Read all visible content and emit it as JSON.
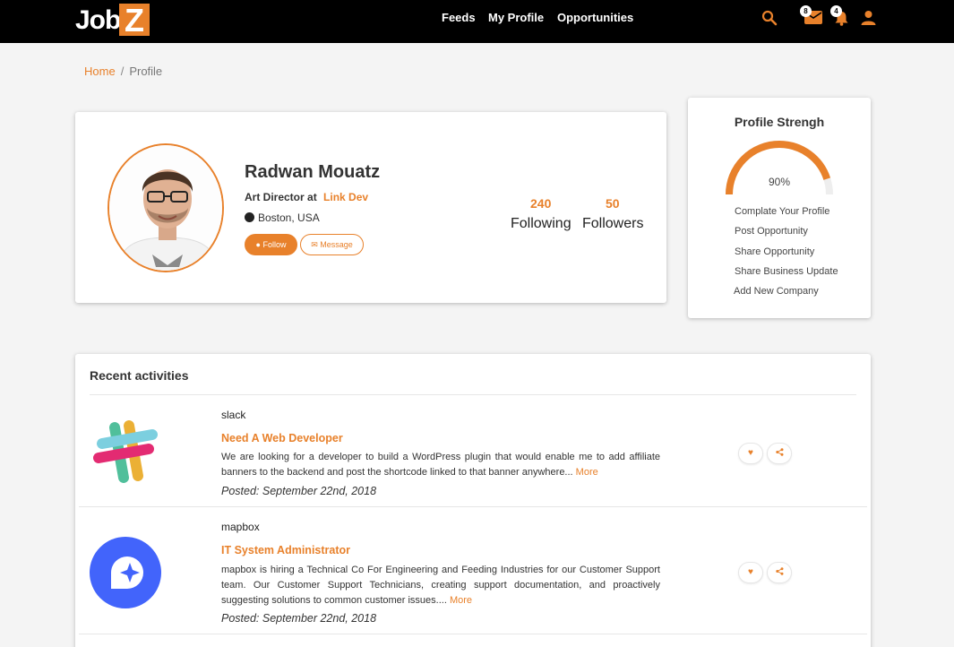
{
  "app": {
    "logo_prefix": "Job",
    "logo_z": "Z"
  },
  "nav": {
    "items": [
      {
        "label": "Feeds"
      },
      {
        "label": "My Profile"
      },
      {
        "label": "Opportunities"
      }
    ],
    "icons": [
      {
        "name": "search-icon"
      },
      {
        "name": "mail-icon",
        "badge": "8"
      },
      {
        "name": "bell-icon",
        "badge": "4"
      },
      {
        "name": "user-icon"
      }
    ]
  },
  "breadcrumb": {
    "home": "Home",
    "separator": "/",
    "current": "Profile"
  },
  "profile": {
    "name": "Radwan Mouatz",
    "title": "Art Director",
    "at": "at",
    "company": "Link Dev",
    "location": "Boston, USA",
    "follow_label": "Follow",
    "message_label": "Message",
    "following_count": "240",
    "following_label": "Following",
    "followers_count": "50",
    "followers_label": "Followers"
  },
  "strength": {
    "title": "Profile Strengh",
    "percent": "90%",
    "value": 0.9,
    "links": [
      "Complate Your Profile",
      "Post Opportunity",
      "Share Opportunity",
      "Share Business Update",
      "Add New Company"
    ]
  },
  "activities": {
    "title": "Recent activities",
    "items": [
      {
        "company": "slack",
        "logo": "slack-logo",
        "job": "Need A Web Developer",
        "description": "We are looking for a developer to build a WordPress plugin that would enable me to add affiliate banners to the backend and post the shortcode linked to that banner anywhere...",
        "more": "More",
        "posted": "Posted: September 22nd, 2018"
      },
      {
        "company": "mapbox",
        "logo": "mapbox-logo",
        "job": "IT System Administrator",
        "description": "mapbox is hiring a Technical Co For Engineering and Feeding Industries for our Customer Support team. Our Customer Support Technicians, creating support documentation, and proactively suggesting solutions to common customer issues....",
        "more": "More",
        "posted": "Posted: September 22nd, 2018"
      }
    ]
  },
  "colors": {
    "accent": "#e8812b",
    "topbar": "#000000",
    "background": "#f4f4f4",
    "mapbox": "#4264fb"
  }
}
